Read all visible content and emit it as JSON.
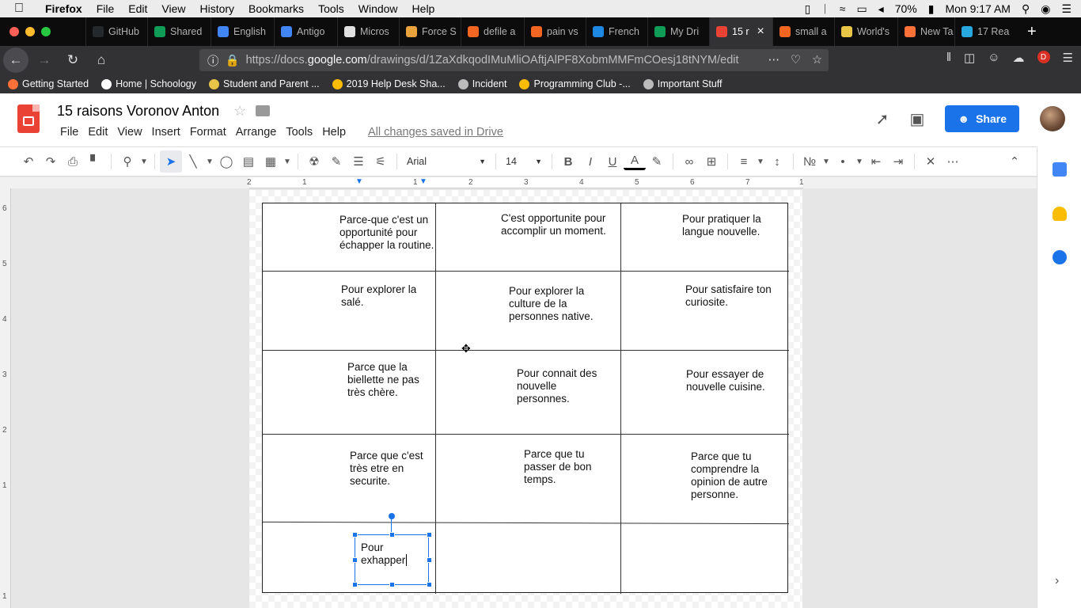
{
  "menubar": {
    "app": "Firefox",
    "items": [
      "File",
      "Edit",
      "View",
      "History",
      "Bookmarks",
      "Tools",
      "Window",
      "Help"
    ],
    "battery": "70%",
    "clock": "Mon 9:17 AM"
  },
  "tabs": [
    {
      "label": "GitHub",
      "color": "#24292e"
    },
    {
      "label": "Shared",
      "color": "#0f9d58"
    },
    {
      "label": "English",
      "color": "#4285f4"
    },
    {
      "label": "Antigo",
      "color": "#4285f4"
    },
    {
      "label": "Micros",
      "color": "#e0e0e0"
    },
    {
      "label": "Force S",
      "color": "#e8a33d"
    },
    {
      "label": "defile a",
      "color": "#f26522"
    },
    {
      "label": "pain vs",
      "color": "#f26522"
    },
    {
      "label": "French",
      "color": "#1e88e5"
    },
    {
      "label": "My Dri",
      "color": "#0f9d58"
    },
    {
      "label": "15 r",
      "color": "#ea4335",
      "active": true
    },
    {
      "label": "small a",
      "color": "#f26522"
    },
    {
      "label": "World's",
      "color": "#e8c547"
    },
    {
      "label": "New Ta",
      "color": "#ff7139"
    },
    {
      "label": "17 Rea",
      "color": "#29a8e0"
    }
  ],
  "url": {
    "prefix": "https://docs.",
    "domain": "google.com",
    "path": "/drawings/d/1ZaXdkqodIMuMliOAftjAlPF8XobmMMFmCOesj18tNYM/edit"
  },
  "bookmarks": [
    {
      "label": "Getting Started",
      "color": "#ff7139"
    },
    {
      "label": "Home | Schoology",
      "color": "#ffffff"
    },
    {
      "label": "Student and Parent ...",
      "color": "#e8c547"
    },
    {
      "label": "2019 Help Desk Sha...",
      "color": "#fbbc05"
    },
    {
      "label": "Incident",
      "color": "#bbbbbb"
    },
    {
      "label": "Programming Club -...",
      "color": "#fbbc05"
    },
    {
      "label": "Important Stuff",
      "color": "#bbbbbb"
    }
  ],
  "doc": {
    "title": "15 raisons Voronov Anton",
    "menu": [
      "File",
      "Edit",
      "View",
      "Insert",
      "Format",
      "Arrange",
      "Tools",
      "Help"
    ],
    "saved_status": "All changes saved in Drive",
    "share_label": "Share"
  },
  "toolbar": {
    "font": "Arial",
    "font_size": "14"
  },
  "ruler": {
    "h_numbers": [
      "2",
      "1",
      "1",
      "2",
      "3",
      "4",
      "5",
      "6",
      "7",
      "1"
    ],
    "v_numbers": [
      "6",
      "5",
      "4",
      "3",
      "2",
      "1",
      "1"
    ]
  },
  "cells": [
    {
      "r": 0,
      "c": 0,
      "text": "Parce-que c'est un opportunité pour échapper la routine."
    },
    {
      "r": 0,
      "c": 1,
      "text": "C'est opportunite pour accomplir un moment."
    },
    {
      "r": 0,
      "c": 2,
      "text": "Pour pratiquer la langue nouvelle."
    },
    {
      "r": 1,
      "c": 0,
      "text": "Pour explorer la salé."
    },
    {
      "r": 1,
      "c": 1,
      "text": "Pour explorer la culture de la personnes native."
    },
    {
      "r": 1,
      "c": 2,
      "text": "Pour satisfaire ton curiosite."
    },
    {
      "r": 2,
      "c": 0,
      "text": "Parce que la biellette ne pas très chère."
    },
    {
      "r": 2,
      "c": 1,
      "text": "Pour connait des nouvelle personnes."
    },
    {
      "r": 2,
      "c": 2,
      "text": "Pour essayer de nouvelle cuisine."
    },
    {
      "r": 3,
      "c": 0,
      "text": "Parce que c'est très etre en securite."
    },
    {
      "r": 3,
      "c": 1,
      "text": "Parce que tu passer de bon temps."
    },
    {
      "r": 3,
      "c": 2,
      "text": "Parce que tu comprendre la opinion de autre personne."
    },
    {
      "r": 4,
      "c": 0,
      "text": "Pour exhapper"
    }
  ],
  "colors": {
    "accent": "#1a73e8",
    "docs_red": "#ea4335"
  }
}
